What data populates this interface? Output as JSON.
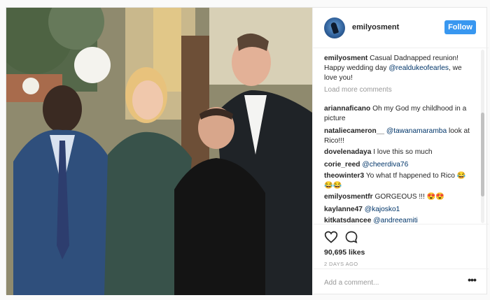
{
  "post": {
    "photo": {
      "alt": ""
    },
    "header": {
      "username": "emilyosment",
      "follow_label": "Follow"
    },
    "caption": {
      "username": "emilyosment",
      "text": "Casual Dadnapped reunion! Happy wedding day",
      "mention": "@realdukeofearles",
      "suffix": ", we love you!"
    },
    "load_more_label": "Load more comments",
    "comments": [
      {
        "username": "ariannaficano",
        "text": "Oh my God my childhood in a picture",
        "mention": ""
      },
      {
        "username": "nataliecameron__",
        "text": "",
        "mention": "@tawanamaramba",
        "after": "look at Rico!!!"
      },
      {
        "username": "dovelenadaya",
        "text": "I love this so much",
        "mention": ""
      },
      {
        "username": "corie_reed",
        "text": "",
        "mention": "@cheerdiva76"
      },
      {
        "username": "theowinter3",
        "text": "Yo what tf happened to Rico 😂😂😂",
        "mention": ""
      },
      {
        "username": "emilyosmentfr",
        "text": "GORGEOUS !!! 😍😍",
        "mention": ""
      },
      {
        "username": "kaylanne47",
        "text": "",
        "mention": "@kajosko1"
      },
      {
        "username": "kitkatsdancee",
        "text": "",
        "mention": "@andreeamiti"
      }
    ],
    "likes": "90,695 likes",
    "timestamp": "2 DAYS AGO",
    "add_comment_placeholder": "Add a comment...",
    "more_label": "•••",
    "colors": {
      "accent": "#3897f0",
      "mention": "#003569",
      "muted": "#999999"
    }
  }
}
